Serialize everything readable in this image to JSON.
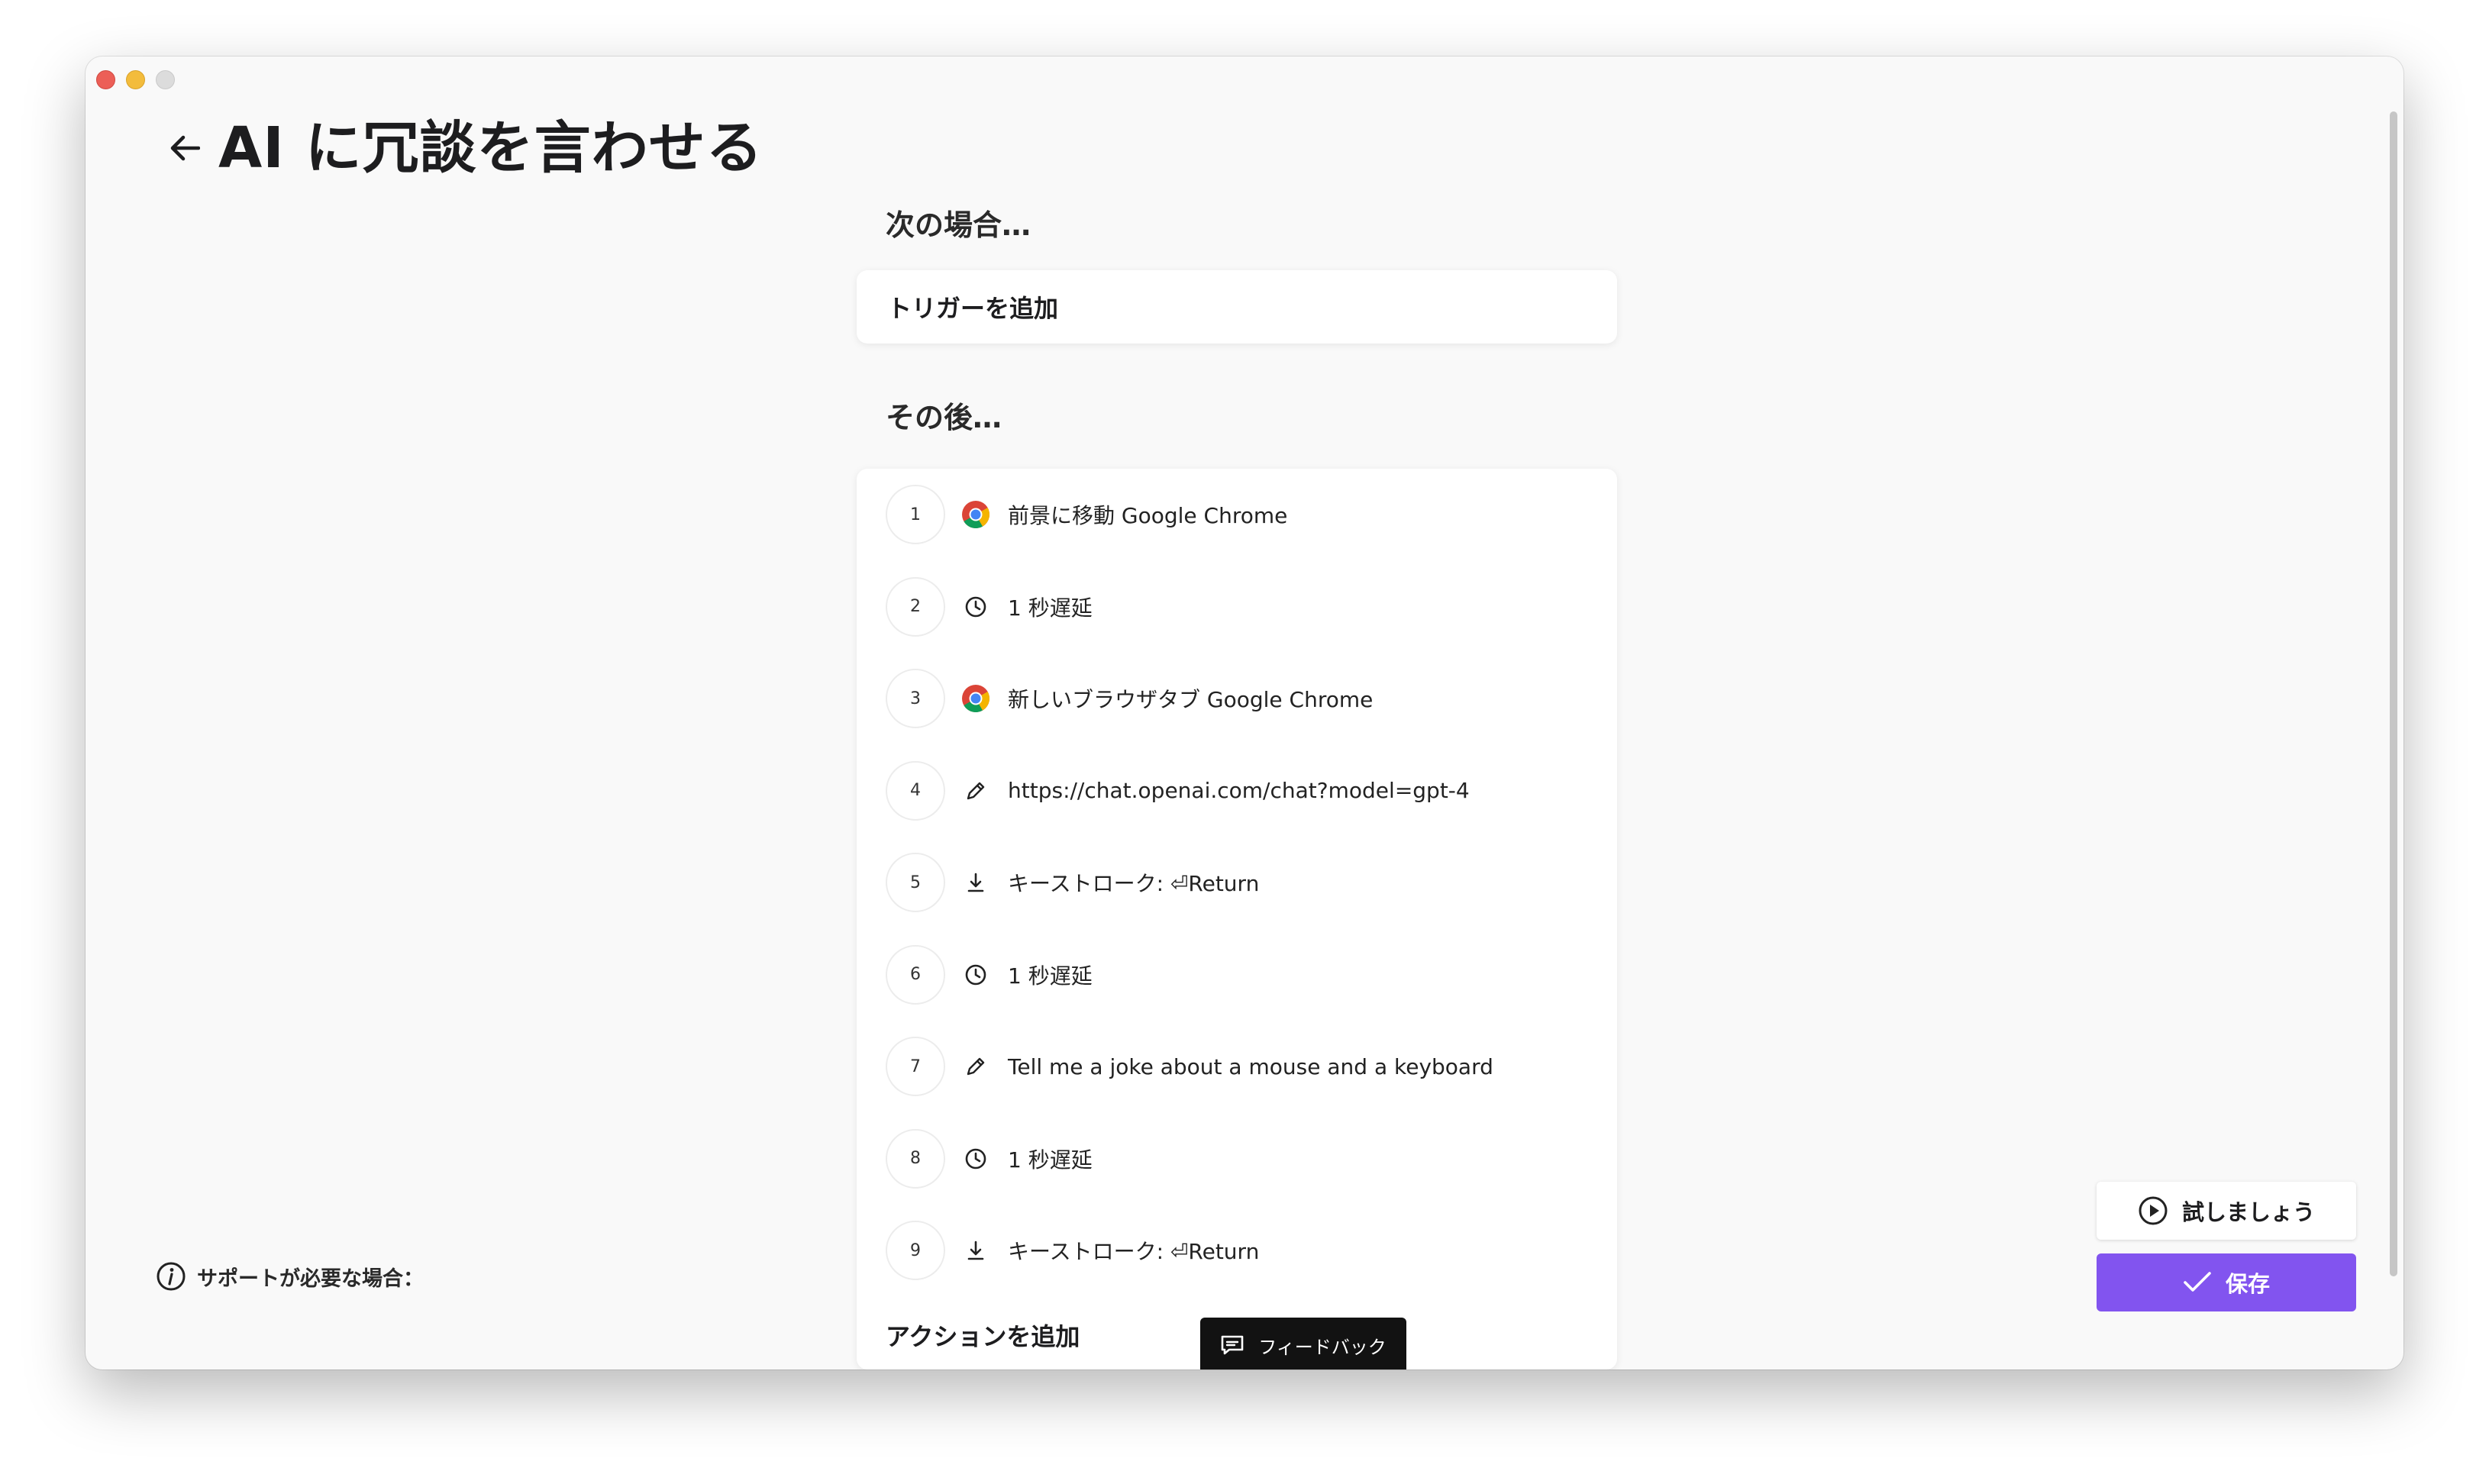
{
  "window": {
    "title": "AI に冗談を言わせる"
  },
  "sections": {
    "when_label": "次の場合…",
    "trigger_button": "トリガーを追加",
    "then_label": "その後…",
    "add_action": "アクションを追加"
  },
  "actions": [
    {
      "num": "1",
      "icon": "chrome-icon",
      "label": "前景に移動 Google Chrome"
    },
    {
      "num": "2",
      "icon": "clock-icon",
      "label": "1 秒遅延"
    },
    {
      "num": "3",
      "icon": "chrome-icon",
      "label": "新しいブラウザタブ Google Chrome"
    },
    {
      "num": "4",
      "icon": "pencil-icon",
      "label": "https://chat.openai.com/chat?model=gpt-4"
    },
    {
      "num": "5",
      "icon": "download-arrow-icon",
      "label": "キーストローク: ⏎Return"
    },
    {
      "num": "6",
      "icon": "clock-icon",
      "label": "1 秒遅延"
    },
    {
      "num": "7",
      "icon": "pencil-icon",
      "label": "Tell me a joke about a mouse and a keyboard"
    },
    {
      "num": "8",
      "icon": "clock-icon",
      "label": "1 秒遅延"
    },
    {
      "num": "9",
      "icon": "download-arrow-icon",
      "label": "キーストローク: ⏎Return"
    }
  ],
  "help": {
    "label": "サポートが必要な場合："
  },
  "buttons": {
    "try": "試しましょう",
    "save": "保存",
    "feedback": "フィードバック"
  },
  "colors": {
    "accent": "#8254ef",
    "feedback_bg": "#121212"
  }
}
